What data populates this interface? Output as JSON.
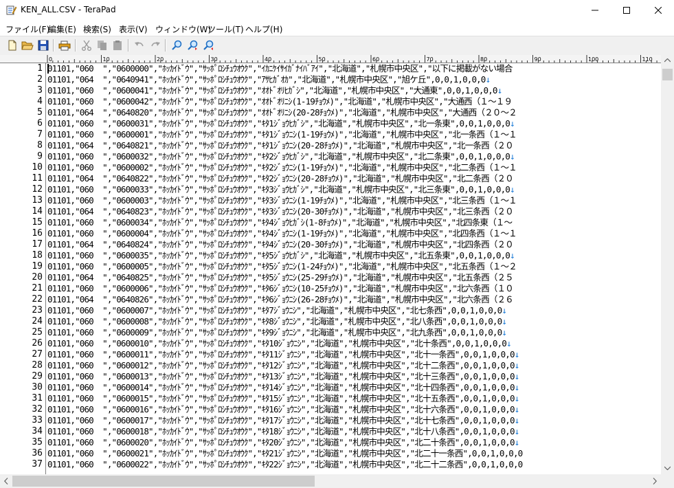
{
  "window": {
    "title": "KEN_ALL.CSV - TeraPad"
  },
  "menu": [
    "ファイル(F)",
    "編集(E)",
    "検索(S)",
    "表示(V)",
    "ウィンドウ(W)",
    "ツール(T)",
    "ヘルプ(H)"
  ],
  "ruler_ticks": [
    "0",
    "10",
    "20",
    "30",
    "40",
    "50",
    "60",
    "70",
    "80",
    "90",
    "100",
    "110"
  ],
  "lines": [
    {
      "n": "1",
      "text": "01101,\"060  \",\"0600000\",\"ﾎｯｶｲﾄﾞｳ\",\"ｻｯﾎﾟﾛｼﾁｭｳｵｳｸ\",\"ｲｶﾆｹｲｻｲｶﾞﾅｲﾊﾞｱｲ\",\"北海道\",\"札幌市中央区\",\"以下に掲載がない場合",
      "eol": ""
    },
    {
      "n": "2",
      "text": "01101,\"064  \",\"0640941\",\"ﾎｯｶｲﾄﾞｳ\",\"ｻｯﾎﾟﾛｼﾁｭｳｵｳｸ\",\"ｱｻﾋｶﾞｵｶ\",\"北海道\",\"札幌市中央区\",\"旭ケ丘\",0,0,1,0,0,0",
      "eol": "↓"
    },
    {
      "n": "3",
      "text": "01101,\"060  \",\"0600041\",\"ﾎｯｶｲﾄﾞｳ\",\"ｻｯﾎﾟﾛｼﾁｭｳｵｳｸ\",\"ｵｵﾄﾞｵﾘﾋｶﾞｼ\",\"北海道\",\"札幌市中央区\",\"大通東\",0,0,1,0,0,0",
      "eol": "↓"
    },
    {
      "n": "4",
      "text": "01101,\"060  \",\"0600042\",\"ﾎｯｶｲﾄﾞｳ\",\"ｻｯﾎﾟﾛｼﾁｭｳｵｳｸ\",\"ｵｵﾄﾞｵﾘﾆｼ(1-19ﾁｮｳﾒ)\",\"北海道\",\"札幌市中央区\",\"大通西（１～１９",
      "eol": ""
    },
    {
      "n": "5",
      "text": "01101,\"064  \",\"0640820\",\"ﾎｯｶｲﾄﾞｳ\",\"ｻｯﾎﾟﾛｼﾁｭｳｵｳｸ\",\"ｵｵﾄﾞｵﾘﾆｼ(20-28ﾁｮｳﾒ)\",\"北海道\",\"札幌市中央区\",\"大通西（２０～２",
      "eol": ""
    },
    {
      "n": "6",
      "text": "01101,\"060  \",\"0600031\",\"ﾎｯｶｲﾄﾞｳ\",\"ｻｯﾎﾟﾛｼﾁｭｳｵｳｸ\",\"ｷﾀ1ｼﾞｮｳﾋｶﾞｼ\",\"北海道\",\"札幌市中央区\",\"北一条東\",0,0,1,0,0,0",
      "eol": "↓"
    },
    {
      "n": "7",
      "text": "01101,\"060  \",\"0600001\",\"ﾎｯｶｲﾄﾞｳ\",\"ｻｯﾎﾟﾛｼﾁｭｳｵｳｸ\",\"ｷﾀ1ｼﾞｮｳﾆｼ(1-19ﾁｮｳﾒ)\",\"北海道\",\"札幌市中央区\",\"北一条西（１～１",
      "eol": ""
    },
    {
      "n": "8",
      "text": "01101,\"064  \",\"0640821\",\"ﾎｯｶｲﾄﾞｳ\",\"ｻｯﾎﾟﾛｼﾁｭｳｵｳｸ\",\"ｷﾀ1ｼﾞｮｳﾆｼ(20-28ﾁｮｳﾒ)\",\"北海道\",\"札幌市中央区\",\"北一条西（２０",
      "eol": ""
    },
    {
      "n": "9",
      "text": "01101,\"060  \",\"0600032\",\"ﾎｯｶｲﾄﾞｳ\",\"ｻｯﾎﾟﾛｼﾁｭｳｵｳｸ\",\"ｷﾀ2ｼﾞｮｳﾋｶﾞｼ\",\"北海道\",\"札幌市中央区\",\"北二条東\",0,0,1,0,0,0",
      "eol": "↓"
    },
    {
      "n": "10",
      "text": "01101,\"060  \",\"0600002\",\"ﾎｯｶｲﾄﾞｳ\",\"ｻｯﾎﾟﾛｼﾁｭｳｵｳｸ\",\"ｷﾀ2ｼﾞｮｳﾆｼ(1-19ﾁｮｳﾒ)\",\"北海道\",\"札幌市中央区\",\"北二条西（１～１",
      "eol": ""
    },
    {
      "n": "11",
      "text": "01101,\"064  \",\"0640822\",\"ﾎｯｶｲﾄﾞｳ\",\"ｻｯﾎﾟﾛｼﾁｭｳｵｳｸ\",\"ｷﾀ2ｼﾞｮｳﾆｼ(20-28ﾁｮｳﾒ)\",\"北海道\",\"札幌市中央区\",\"北二条西（２０",
      "eol": ""
    },
    {
      "n": "12",
      "text": "01101,\"060  \",\"0600033\",\"ﾎｯｶｲﾄﾞｳ\",\"ｻｯﾎﾟﾛｼﾁｭｳｵｳｸ\",\"ｷﾀ3ｼﾞｮｳﾋｶﾞｼ\",\"北海道\",\"札幌市中央区\",\"北三条東\",0,0,1,0,0,0",
      "eol": "↓"
    },
    {
      "n": "13",
      "text": "01101,\"060  \",\"0600003\",\"ﾎｯｶｲﾄﾞｳ\",\"ｻｯﾎﾟﾛｼﾁｭｳｵｳｸ\",\"ｷﾀ3ｼﾞｮｳﾆｼ(1-19ﾁｮｳﾒ)\",\"北海道\",\"札幌市中央区\",\"北三条西（１～１",
      "eol": ""
    },
    {
      "n": "14",
      "text": "01101,\"064  \",\"0640823\",\"ﾎｯｶｲﾄﾞｳ\",\"ｻｯﾎﾟﾛｼﾁｭｳｵｳｸ\",\"ｷﾀ3ｼﾞｮｳﾆｼ(20-30ﾁｮｳﾒ)\",\"北海道\",\"札幌市中央区\",\"北三条西（２０",
      "eol": ""
    },
    {
      "n": "15",
      "text": "01101,\"060  \",\"0600034\",\"ﾎｯｶｲﾄﾞｳ\",\"ｻｯﾎﾟﾛｼﾁｭｳｵｳｸ\",\"ｷﾀ4ｼﾞｮｳﾋｶﾞｼ(1-8ﾁｮｳﾒ)\",\"北海道\",\"札幌市中央区\",\"北四条東（１～",
      "eol": ""
    },
    {
      "n": "16",
      "text": "01101,\"060  \",\"0600004\",\"ﾎｯｶｲﾄﾞｳ\",\"ｻｯﾎﾟﾛｼﾁｭｳｵｳｸ\",\"ｷﾀ4ｼﾞｮｳﾆｼ(1-19ﾁｮｳﾒ)\",\"北海道\",\"札幌市中央区\",\"北四条西（１～１",
      "eol": ""
    },
    {
      "n": "17",
      "text": "01101,\"064  \",\"0640824\",\"ﾎｯｶｲﾄﾞｳ\",\"ｻｯﾎﾟﾛｼﾁｭｳｵｳｸ\",\"ｷﾀ4ｼﾞｮｳﾆｼ(20-30ﾁｮｳﾒ)\",\"北海道\",\"札幌市中央区\",\"北四条西（２０",
      "eol": ""
    },
    {
      "n": "18",
      "text": "01101,\"060  \",\"0600035\",\"ﾎｯｶｲﾄﾞｳ\",\"ｻｯﾎﾟﾛｼﾁｭｳｵｳｸ\",\"ｷﾀ5ｼﾞｮｳﾋｶﾞｼ\",\"北海道\",\"札幌市中央区\",\"北五条東\",0,0,1,0,0,0",
      "eol": "↓"
    },
    {
      "n": "19",
      "text": "01101,\"060  \",\"0600005\",\"ﾎｯｶｲﾄﾞｳ\",\"ｻｯﾎﾟﾛｼﾁｭｳｵｳｸ\",\"ｷﾀ5ｼﾞｮｳﾆｼ(1-24ﾁｮｳﾒ)\",\"北海道\",\"札幌市中央区\",\"北五条西（１～２",
      "eol": ""
    },
    {
      "n": "20",
      "text": "01101,\"064  \",\"0640825\",\"ﾎｯｶｲﾄﾞｳ\",\"ｻｯﾎﾟﾛｼﾁｭｳｵｳｸ\",\"ｷﾀ5ｼﾞｮｳﾆｼ(25-29ﾁｮｳﾒ)\",\"北海道\",\"札幌市中央区\",\"北五条西（２５",
      "eol": ""
    },
    {
      "n": "21",
      "text": "01101,\"060  \",\"0600006\",\"ﾎｯｶｲﾄﾞｳ\",\"ｻｯﾎﾟﾛｼﾁｭｳｵｳｸ\",\"ｷﾀ6ｼﾞｮｳﾆｼ(10-25ﾁｮｳﾒ)\",\"北海道\",\"札幌市中央区\",\"北六条西（１０",
      "eol": ""
    },
    {
      "n": "22",
      "text": "01101,\"064  \",\"0640826\",\"ﾎｯｶｲﾄﾞｳ\",\"ｻｯﾎﾟﾛｼﾁｭｳｵｳｸ\",\"ｷﾀ6ｼﾞｮｳﾆｼ(26-28ﾁｮｳﾒ)\",\"北海道\",\"札幌市中央区\",\"北六条西（２６",
      "eol": ""
    },
    {
      "n": "23",
      "text": "01101,\"060  \",\"0600007\",\"ﾎｯｶｲﾄﾞｳ\",\"ｻｯﾎﾟﾛｼﾁｭｳｵｳｸ\",\"ｷﾀ7ｼﾞｮｳﾆｼ\",\"北海道\",\"札幌市中央区\",\"北七条西\",0,0,1,0,0,0",
      "eol": "↓"
    },
    {
      "n": "24",
      "text": "01101,\"060  \",\"0600008\",\"ﾎｯｶｲﾄﾞｳ\",\"ｻｯﾎﾟﾛｼﾁｭｳｵｳｸ\",\"ｷﾀ8ｼﾞｮｳﾆｼ\",\"北海道\",\"札幌市中央区\",\"北八条西\",0,0,1,0,0,0",
      "eol": "↓"
    },
    {
      "n": "25",
      "text": "01101,\"060  \",\"0600009\",\"ﾎｯｶｲﾄﾞｳ\",\"ｻｯﾎﾟﾛｼﾁｭｳｵｳｸ\",\"ｷﾀ9ｼﾞｮｳﾆｼ\",\"北海道\",\"札幌市中央区\",\"北九条西\",0,0,1,0,0,0",
      "eol": "↓"
    },
    {
      "n": "26",
      "text": "01101,\"060  \",\"0600010\",\"ﾎｯｶｲﾄﾞｳ\",\"ｻｯﾎﾟﾛｼﾁｭｳｵｳｸ\",\"ｷﾀ10ｼﾞｮｳﾆｼ\",\"北海道\",\"札幌市中央区\",\"北十条西\",0,0,1,0,0,0",
      "eol": "↓"
    },
    {
      "n": "27",
      "text": "01101,\"060  \",\"0600011\",\"ﾎｯｶｲﾄﾞｳ\",\"ｻｯﾎﾟﾛｼﾁｭｳｵｳｸ\",\"ｷﾀ11ｼﾞｮｳﾆｼ\",\"北海道\",\"札幌市中央区\",\"北十一条西\",0,0,1,0,0,0",
      "eol": "↓"
    },
    {
      "n": "28",
      "text": "01101,\"060  \",\"0600012\",\"ﾎｯｶｲﾄﾞｳ\",\"ｻｯﾎﾟﾛｼﾁｭｳｵｳｸ\",\"ｷﾀ12ｼﾞｮｳﾆｼ\",\"北海道\",\"札幌市中央区\",\"北十二条西\",0,0,1,0,0,0",
      "eol": "↓"
    },
    {
      "n": "29",
      "text": "01101,\"060  \",\"0600013\",\"ﾎｯｶｲﾄﾞｳ\",\"ｻｯﾎﾟﾛｼﾁｭｳｵｳｸ\",\"ｷﾀ13ｼﾞｮｳﾆｼ\",\"北海道\",\"札幌市中央区\",\"北十三条西\",0,0,1,0,0,0",
      "eol": "↓"
    },
    {
      "n": "30",
      "text": "01101,\"060  \",\"0600014\",\"ﾎｯｶｲﾄﾞｳ\",\"ｻｯﾎﾟﾛｼﾁｭｳｵｳｸ\",\"ｷﾀ14ｼﾞｮｳﾆｼ\",\"北海道\",\"札幌市中央区\",\"北十四条西\",0,0,1,0,0,0",
      "eol": "↓"
    },
    {
      "n": "31",
      "text": "01101,\"060  \",\"0600015\",\"ﾎｯｶｲﾄﾞｳ\",\"ｻｯﾎﾟﾛｼﾁｭｳｵｳｸ\",\"ｷﾀ15ｼﾞｮｳﾆｼ\",\"北海道\",\"札幌市中央区\",\"北十五条西\",0,0,1,0,0,0",
      "eol": "↓"
    },
    {
      "n": "32",
      "text": "01101,\"060  \",\"0600016\",\"ﾎｯｶｲﾄﾞｳ\",\"ｻｯﾎﾟﾛｼﾁｭｳｵｳｸ\",\"ｷﾀ16ｼﾞｮｳﾆｼ\",\"北海道\",\"札幌市中央区\",\"北十六条西\",0,0,1,0,0,0",
      "eol": "↓"
    },
    {
      "n": "33",
      "text": "01101,\"060  \",\"0600017\",\"ﾎｯｶｲﾄﾞｳ\",\"ｻｯﾎﾟﾛｼﾁｭｳｵｳｸ\",\"ｷﾀ17ｼﾞｮｳﾆｼ\",\"北海道\",\"札幌市中央区\",\"北十七条西\",0,0,1,0,0,0",
      "eol": "↓"
    },
    {
      "n": "34",
      "text": "01101,\"060  \",\"0600018\",\"ﾎｯｶｲﾄﾞｳ\",\"ｻｯﾎﾟﾛｼﾁｭｳｵｳｸ\",\"ｷﾀ18ｼﾞｮｳﾆｼ\",\"北海道\",\"札幌市中央区\",\"北十八条西\",0,0,1,0,0,0",
      "eol": "↓"
    },
    {
      "n": "35",
      "text": "01101,\"060  \",\"0600020\",\"ﾎｯｶｲﾄﾞｳ\",\"ｻｯﾎﾟﾛｼﾁｭｳｵｳｸ\",\"ｷﾀ20ｼﾞｮｳﾆｼ\",\"北海道\",\"札幌市中央区\",\"北二十条西\",0,0,1,0,0,0",
      "eol": "↓"
    },
    {
      "n": "36",
      "text": "01101,\"060  \",\"0600021\",\"ﾎｯｶｲﾄﾞｳ\",\"ｻｯﾎﾟﾛｼﾁｭｳｵｳｸ\",\"ｷﾀ21ｼﾞｮｳﾆｼ\",\"北海道\",\"札幌市中央区\",\"北二十一条西\",0,0,1,0,0,0",
      "eol": ""
    },
    {
      "n": "37",
      "text": "01101,\"060  \",\"0600022\",\"ﾎｯｶｲﾄﾞｳ\",\"ｻｯﾎﾟﾛｼﾁｭｳｵｳｸ\",\"ｷﾀ22ｼﾞｮｳﾆｼ\",\"北海道\",\"札幌市中央区\",\"北二十二条西\",0,0,1,0,0,0",
      "eol": ""
    }
  ]
}
